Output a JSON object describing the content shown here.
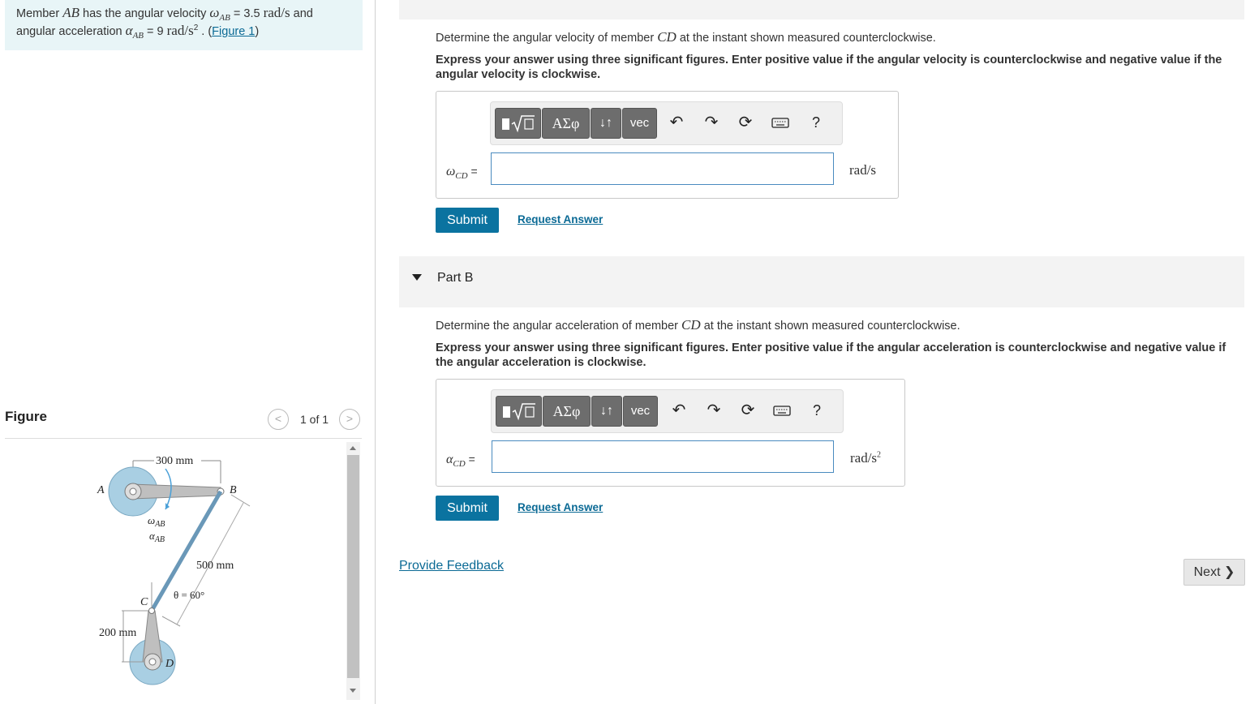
{
  "problem": {
    "t1": "Member ",
    "ab": "AB",
    "t2": " has the angular velocity ",
    "omega": "ω",
    "ab_sub": "AB",
    "t3": " = 3.5 ",
    "unit_v": "rad/s",
    "t4": " and",
    "t5": "angular acceleration ",
    "alpha": "α",
    "ab_sub2": "AB",
    "t6": " = 9 ",
    "unit_a": "rad/s",
    "sq": "2",
    "t7": " . (",
    "figure_link": "Figure 1",
    "t8": ")"
  },
  "figure": {
    "title": "Figure",
    "count": "1 of 1",
    "prev": "<",
    "next": ">",
    "dim_300": "300 mm",
    "dim_500": "500 mm",
    "dim_200": "200 mm",
    "theta": "θ = 60°",
    "lbl_a": "A",
    "lbl_b": "B",
    "lbl_c": "C",
    "lbl_d": "D",
    "lbl_omega": "ω",
    "lbl_alpha": "α",
    "lbl_ab": "AB"
  },
  "partA": {
    "q1": "Determine the angular velocity of member ",
    "cd": "CD",
    "q2": " at the instant shown measured counterclockwise.",
    "instr": "Express your answer using three significant figures. Enter positive value if the angular velocity is counterclockwise and negative value if the angular velocity is clockwise.",
    "var_sym": "ω",
    "var_sub": "CD",
    "eq": " =",
    "unit": "rad/s",
    "input_value": "",
    "submit": "Submit",
    "request": "Request Answer"
  },
  "partB": {
    "header": "Part B",
    "q1": "Determine the angular acceleration of member ",
    "cd": "CD",
    "q2": " at the instant shown measured counterclockwise.",
    "instr": "Express your answer using three significant figures. Enter positive value if the angular acceleration is counterclockwise and negative value if the angular acceleration is clockwise.",
    "var_sym": "α",
    "var_sub": "CD",
    "eq": " =",
    "unit": "rad/s",
    "unit_exp": "2",
    "input_value": "",
    "submit": "Submit",
    "request": "Request Answer"
  },
  "toolbar": {
    "greek": "ΑΣφ",
    "arrows": "↓↑",
    "vec": "vec",
    "help": "?",
    "icons": [
      "templates-icon",
      "undo-icon",
      "redo-icon",
      "reset-icon",
      "keyboard-icon",
      "help-icon"
    ]
  },
  "footer": {
    "feedback": "Provide Feedback",
    "next": "Next"
  },
  "colors": {
    "problem_bg": "#e8f5f7",
    "primary": "#0b73a0",
    "link": "#0b6a95",
    "disk_fill": "#a9cfe3"
  }
}
